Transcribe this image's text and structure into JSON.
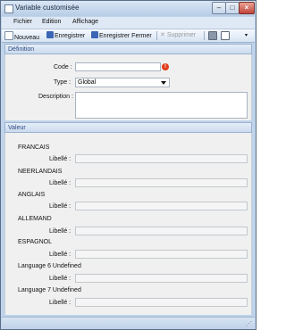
{
  "window": {
    "title": "Variable customisée"
  },
  "menu": [
    "Fichier",
    "Edition",
    "Affichage"
  ],
  "toolbar": {
    "new_label": "Nouveau",
    "save_label": "Enregistrer",
    "save_close_label": "Enregistrer Fermer",
    "delete_label": "Supprimer"
  },
  "definition": {
    "header": "Définition",
    "code_label": "Code :",
    "code_value": "",
    "type_label": "Type :",
    "type_value": "Global",
    "description_label": "Description :",
    "description_value": ""
  },
  "valeur": {
    "header": "Valeur",
    "libelle_label": "Libellé :",
    "languages": [
      {
        "name": "FRANCAIS",
        "value": ""
      },
      {
        "name": "NEERLANDAIS",
        "value": ""
      },
      {
        "name": "ANGLAIS",
        "value": ""
      },
      {
        "name": "ALLEMAND",
        "value": ""
      },
      {
        "name": "ESPAGNOL",
        "value": ""
      },
      {
        "name": "Language 6 Undefined",
        "value": ""
      },
      {
        "name": "Language 7 Undefined",
        "value": ""
      }
    ]
  },
  "colors": {
    "accent": "#2d4c7e",
    "frame": "#bfd3ea",
    "error": "#e23c1a"
  }
}
